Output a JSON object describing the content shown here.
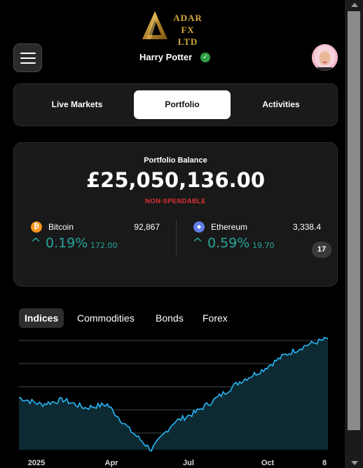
{
  "header": {
    "logo_text_line1": "ADAR FX",
    "logo_text_line2": "LTD",
    "username": "Harry Potter"
  },
  "tabs": [
    {
      "label": "Live Markets",
      "active": false
    },
    {
      "label": "Portfolio",
      "active": true
    },
    {
      "label": "Activities",
      "active": false
    }
  ],
  "portfolio": {
    "balance_label": "Portfolio Balance",
    "balance_value": "£25,050,136.00",
    "balance_note": "NON-SPENDABLE",
    "coins": [
      {
        "name": "Bitcoin",
        "icon": "bitcoin-icon",
        "icon_glyph": "₿",
        "icon_color": "#f7931a",
        "price": "92,867",
        "change_pct": "^ 0.19%",
        "change_abs": "172.00"
      },
      {
        "name": "Ethereum",
        "icon": "ethereum-icon",
        "icon_glyph": "◆",
        "icon_color": "#627eea",
        "price": "3,338.4",
        "change_pct": "^ 0.59%",
        "change_abs": "19.70"
      }
    ],
    "tv_badge": "17"
  },
  "market_tabs": [
    {
      "label": "Indices",
      "active": true
    },
    {
      "label": "Commodities",
      "active": false
    },
    {
      "label": "Bonds",
      "active": false
    },
    {
      "label": "Forex",
      "active": false
    }
  ],
  "colors": {
    "accent_gold": "#d4a93e",
    "positive": "#26a69a",
    "warning": "#e03131",
    "chart_line": "#29b6f6"
  },
  "chart_data": {
    "type": "area",
    "x_tick_labels": [
      "2025",
      "Apr",
      "Jul",
      "Oct",
      "8"
    ],
    "x": [
      0,
      4,
      8,
      12,
      16,
      20,
      24,
      28,
      32,
      36,
      40,
      44,
      48,
      52,
      56
    ],
    "values": [
      0.46,
      0.4,
      0.44,
      0.37,
      0.4,
      0.18,
      0.0,
      0.24,
      0.33,
      0.46,
      0.6,
      0.7,
      0.83,
      0.92,
      0.98
    ],
    "grid": true,
    "legend": "none"
  }
}
